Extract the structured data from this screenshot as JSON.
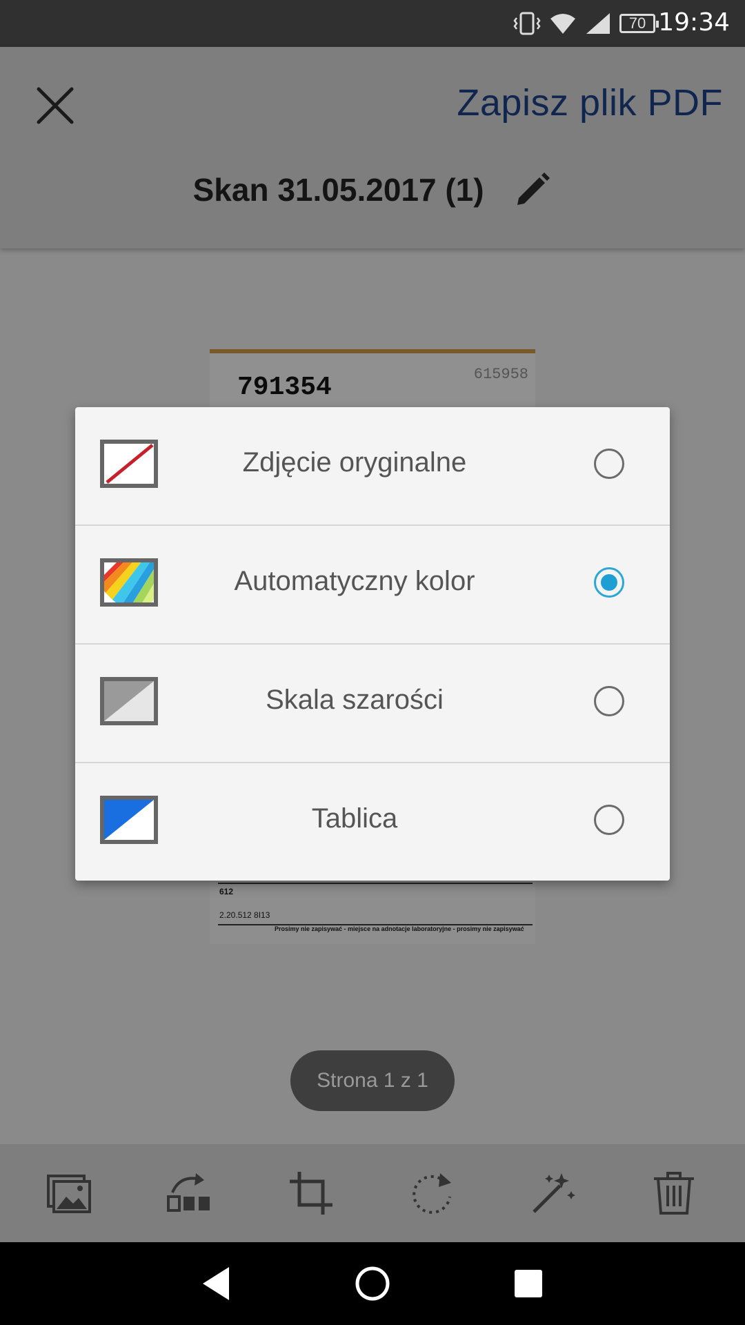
{
  "status_bar": {
    "time": "19:34",
    "battery": "70",
    "icons": [
      "vibrate-icon",
      "wifi-icon",
      "signal-icon",
      "battery-icon"
    ]
  },
  "app_bar": {
    "close_icon": "close-icon",
    "save_label": "Zapisz plik PDF",
    "title": "Skan 31.05.2017 (1)",
    "edit_icon": "pencil-icon"
  },
  "preview": {
    "number": "791354",
    "number2": "615958",
    "footer_text": "Prosimy nie zapisywać - miejsce na adnotacje laboratoryjne - prosimy nie zapisywać",
    "footer_code": "2.20.512 8I13",
    "footer_num": "612"
  },
  "filter_dialog": {
    "options": [
      {
        "label": "Zdjęcie oryginalne",
        "icon": "original-photo-icon",
        "selected": false
      },
      {
        "label": "Automatyczny kolor",
        "icon": "auto-color-icon",
        "selected": true
      },
      {
        "label": "Skala szarości",
        "icon": "grayscale-icon",
        "selected": false
      },
      {
        "label": "Tablica",
        "icon": "whiteboard-icon",
        "selected": false
      }
    ],
    "accent_color": "#1e9fd4"
  },
  "page_indicator": "Strona 1 z 1",
  "toolbar": {
    "buttons": [
      "add-image-icon",
      "reorder-icon",
      "crop-icon",
      "rotate-icon",
      "magic-wand-icon",
      "delete-icon"
    ]
  },
  "nav_bar": {
    "buttons": [
      "back-icon",
      "home-icon",
      "recents-icon"
    ]
  },
  "colors": {
    "save_text": "#10264f",
    "status_bar": "#303030",
    "overlay": "#8a8a8a"
  }
}
